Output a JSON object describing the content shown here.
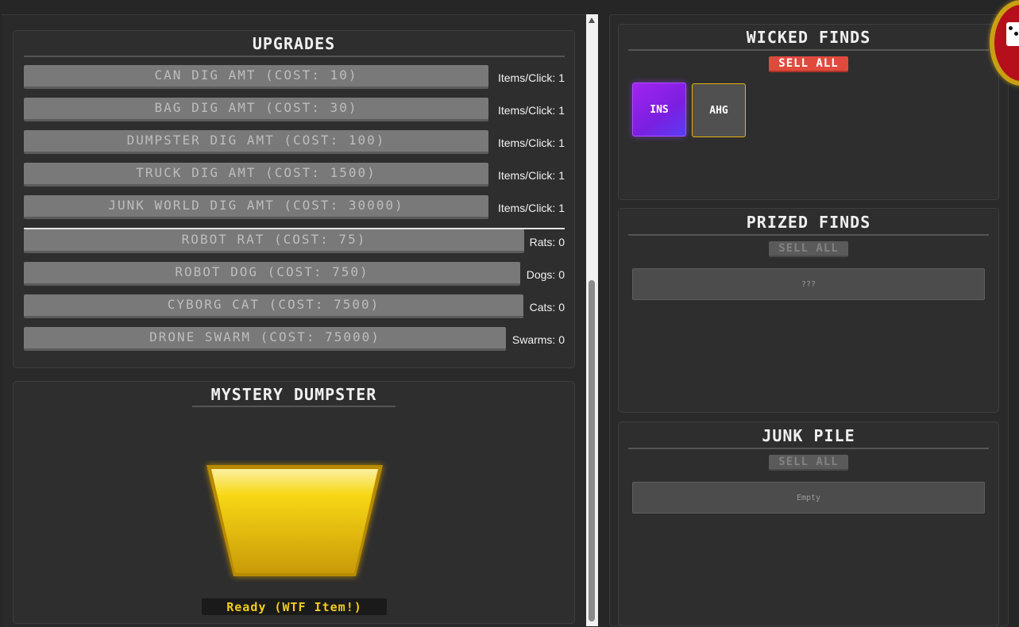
{
  "upgrades": {
    "title": "UPGRADES",
    "dig_items": [
      {
        "label": "CAN DIG AMT (COST: 10)",
        "stat": "Items/Click: 1"
      },
      {
        "label": "BAG DIG AMT (COST: 30)",
        "stat": "Items/Click: 1"
      },
      {
        "label": "DUMPSTER DIG AMT (COST: 100)",
        "stat": "Items/Click: 1"
      },
      {
        "label": "TRUCK DIG AMT (COST: 1500)",
        "stat": "Items/Click: 1"
      },
      {
        "label": "JUNK WORLD DIG AMT (COST: 30000)",
        "stat": "Items/Click: 1"
      }
    ],
    "robot_items": [
      {
        "label": "ROBOT RAT (COST: 75)",
        "stat": "Rats: 0"
      },
      {
        "label": "ROBOT DOG (COST: 750)",
        "stat": "Dogs: 0"
      },
      {
        "label": "CYBORG CAT (COST: 7500)",
        "stat": "Cats: 0"
      },
      {
        "label": "DRONE SWARM (COST: 75000)",
        "stat": "Swarms: 0"
      }
    ]
  },
  "mystery": {
    "title": "MYSTERY DUMPSTER",
    "status": "Ready (WTF Item!)",
    "dumpster_color": "#f2cc1a"
  },
  "wicked": {
    "title": "WICKED FINDS",
    "sell_label": "SELL ALL",
    "items": [
      {
        "code": "INS",
        "color": "#9b24ee"
      },
      {
        "code": "AHG",
        "color": "#505050"
      }
    ]
  },
  "prized": {
    "title": "PRIZED FINDS",
    "sell_label": "SELL ALL",
    "placeholder": "???"
  },
  "junk": {
    "title": "JUNK PILE",
    "sell_label": "SELL ALL",
    "placeholder": "Empty"
  },
  "colors": {
    "sell_active": "#e04a3d",
    "accent_gold": "#e5b40f",
    "badge_red": "#b50f1c"
  }
}
